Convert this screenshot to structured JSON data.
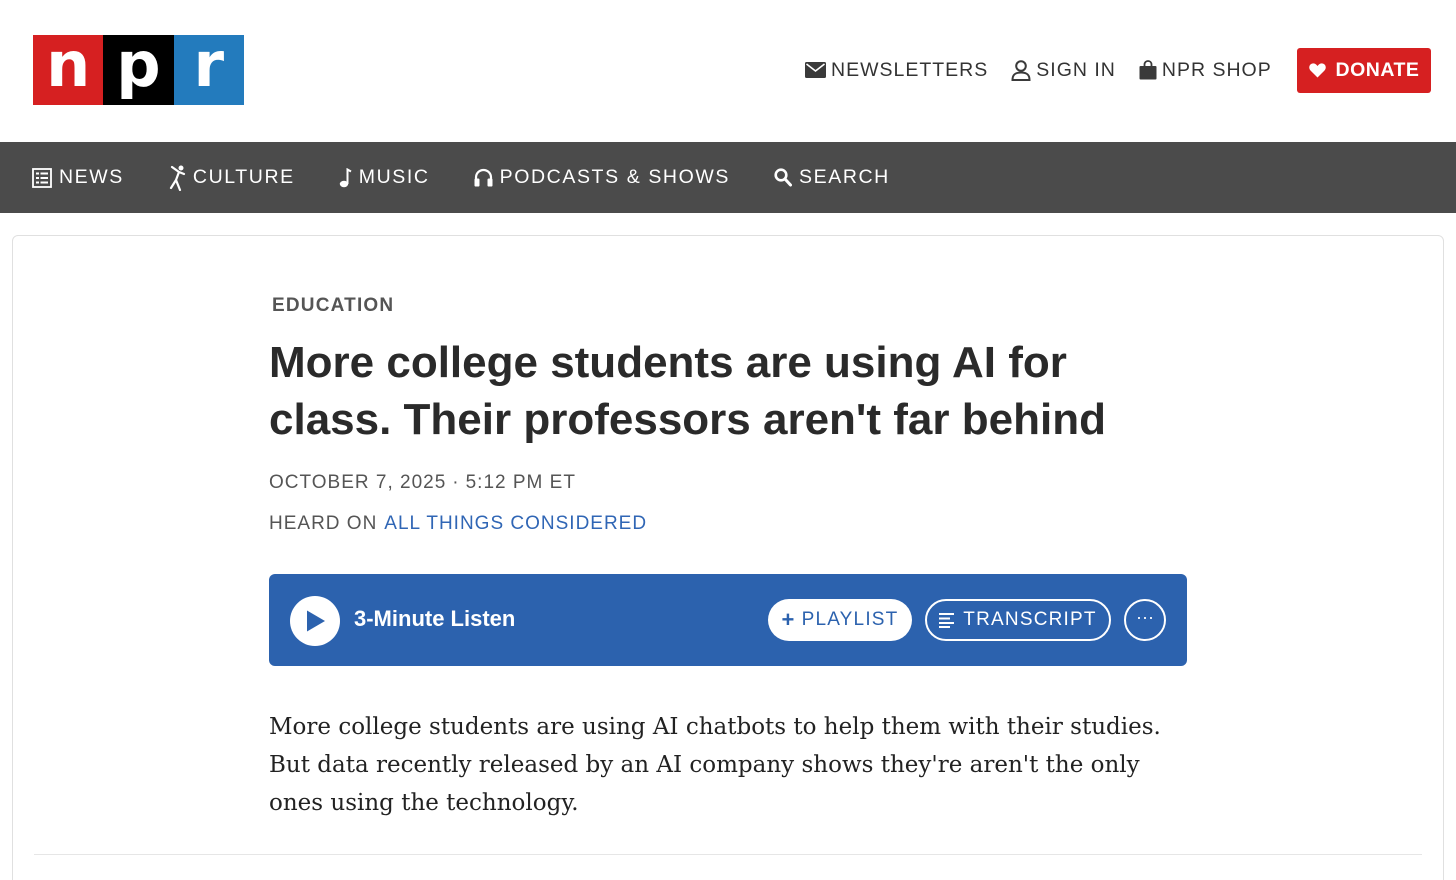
{
  "logo": {
    "letters": [
      "n",
      "p",
      "r"
    ],
    "colors": [
      "#d62021",
      "#000000",
      "#237bbd"
    ]
  },
  "header": {
    "utility_nav": [
      {
        "label": "NEWSLETTERS",
        "icon": "envelope-icon"
      },
      {
        "label": "SIGN IN",
        "icon": "user-icon"
      },
      {
        "label": "NPR SHOP",
        "icon": "shopping-bag-icon"
      }
    ],
    "donate": {
      "label": "DONATE",
      "icon": "heart-icon",
      "color": "#d62021"
    }
  },
  "main_nav": [
    {
      "label": "NEWS",
      "icon": "newspaper-icon"
    },
    {
      "label": "CULTURE",
      "icon": "dancer-icon"
    },
    {
      "label": "MUSIC",
      "icon": "music-note-icon"
    },
    {
      "label": "PODCASTS & SHOWS",
      "icon": "headphones-icon"
    },
    {
      "label": "SEARCH",
      "icon": "search-icon"
    }
  ],
  "article": {
    "slug": "EDUCATION",
    "headline": "More college students are using AI for class. Their professors aren't far behind",
    "date": "OCTOBER 7, 2025",
    "date_sep": "·",
    "time": "5:12 PM ET",
    "heard_on_prefix": "HEARD ON",
    "heard_on_show": "ALL THINGS CONSIDERED",
    "teaser": "More college students are using AI chatbots to help them with their studies. But data recently released by an AI company shows they're aren't the only ones using the technology."
  },
  "player": {
    "listen_label": "3-Minute Listen",
    "playlist_plus": "+",
    "playlist_label": "PLAYLIST",
    "transcript_label": "TRANSCRIPT",
    "more_label": "···",
    "color": "#2c62ae"
  }
}
